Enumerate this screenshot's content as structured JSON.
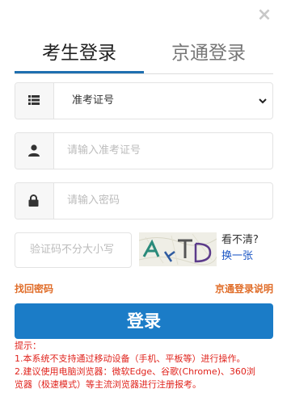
{
  "close": {
    "glyph": "×"
  },
  "tabs": [
    {
      "label": "考生登录",
      "active": true
    },
    {
      "label": "京通登录",
      "active": false
    }
  ],
  "id_type_select": {
    "selected": "准考证号"
  },
  "exam_number_input": {
    "placeholder": "请输入准考证号"
  },
  "password_input": {
    "placeholder": "请输入密码"
  },
  "captcha": {
    "placeholder": "验证码不分大小写",
    "unclear_text": "看不清?",
    "refresh_text": "换一张"
  },
  "links": {
    "forgot_password": "找回密码",
    "jingtong_help": "京通登录说明"
  },
  "login_button": {
    "label": "登录"
  },
  "tips": [
    "提示：",
    "1.本系统不支持通过移动设备（手机、平板等）进行操作。",
    "2.建议使用电脑浏览器：微软Edge、谷歌(Chrome)、360浏",
    "览器（极速模式）等主流浏览器进行注册报考。"
  ],
  "colors": {
    "accent": "#1b7cc7",
    "tab_underline": "#1e6fb0",
    "link_orange": "#e06d29",
    "tip_red": "#e0231c",
    "refresh_blue": "#1a55c4"
  }
}
